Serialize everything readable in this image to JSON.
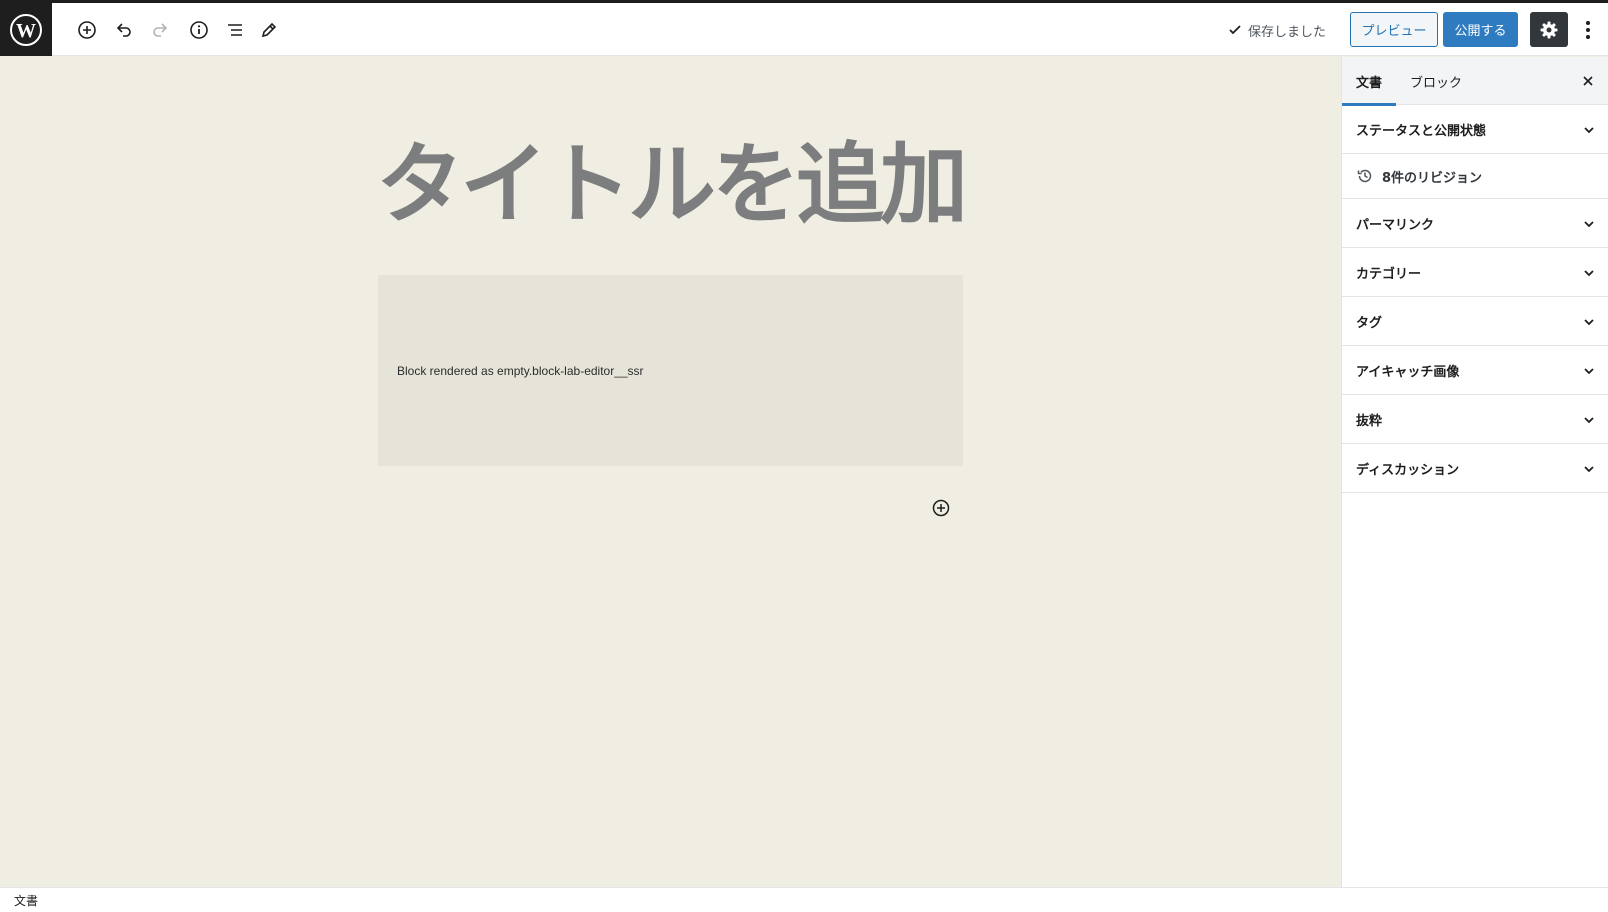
{
  "toolbar": {
    "logo": "wordpress-icon",
    "tools": [
      "add-block-icon",
      "undo-icon",
      "redo-icon",
      "info-icon",
      "list-view-icon",
      "edit-icon"
    ],
    "saved_label": "保存しました",
    "preview_label": "プレビュー",
    "publish_label": "公開する"
  },
  "editor": {
    "title_placeholder": "タイトルを追加",
    "ssr_block_text": "Block rendered as empty.block-lab-editor__ssr"
  },
  "sidebar": {
    "tabs": [
      "文書",
      "ブロック"
    ],
    "active_tab": "文書",
    "status_panel": "ステータスと公開状態",
    "revisions": "8件のリビジョン",
    "panels": [
      "パーマリンク",
      "カテゴリー",
      "タグ",
      "アイキャッチ画像",
      "抜粋",
      "ディスカッション"
    ]
  },
  "footer": {
    "breadcrumb": "文書"
  },
  "colors": {
    "accent": "#2e7cbf",
    "canvas_bg": "#f0ede2",
    "block_bg": "#e6e3d8",
    "title_gray": "#7c7d7e"
  }
}
